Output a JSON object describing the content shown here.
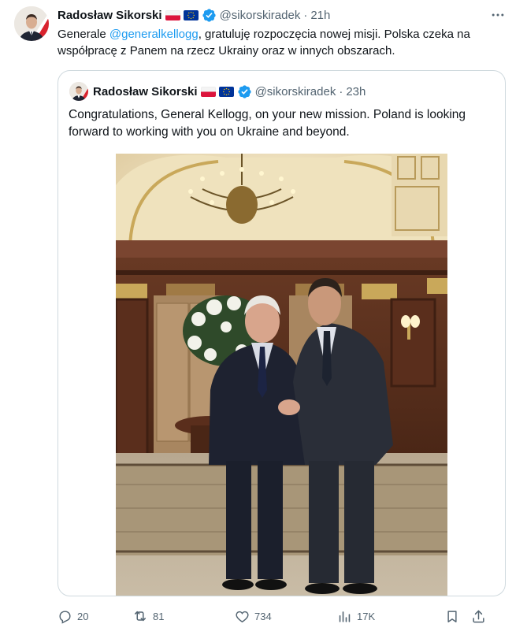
{
  "post": {
    "author_name": "Radosław Sikorski",
    "handle": "@sikorskiradek",
    "separator": "·",
    "time": "21h",
    "text_parts": {
      "before": "Generale ",
      "mention": "@generalkellogg",
      "after": ", gratuluję rozpoczęcia nowej misji. Polska czeka na współpracę z Panem na rzecz Ukrainy oraz w innych obszarach."
    }
  },
  "quoted_post": {
    "author_name": "Radosław Sikorski",
    "handle": "@sikorskiradek",
    "separator": "·",
    "time": "23h",
    "text": "Congratulations, General Kellogg, on your new mission.  Poland is looking forward to working with you on Ukraine and beyond."
  },
  "actions": {
    "replies": "20",
    "reposts": "81",
    "likes": "734",
    "views": "17K"
  },
  "icons": {
    "more": "more-horizontal-icon",
    "verified": "verified-badge-icon",
    "reply": "reply-icon",
    "repost": "repost-icon",
    "like": "heart-icon",
    "views": "analytics-icon",
    "bookmark": "bookmark-icon",
    "share": "share-icon"
  },
  "colors": {
    "verified": "#1d9bf0",
    "mention": "#1d9bf0",
    "secondary_text": "#536471",
    "border": "#cfd9de"
  }
}
